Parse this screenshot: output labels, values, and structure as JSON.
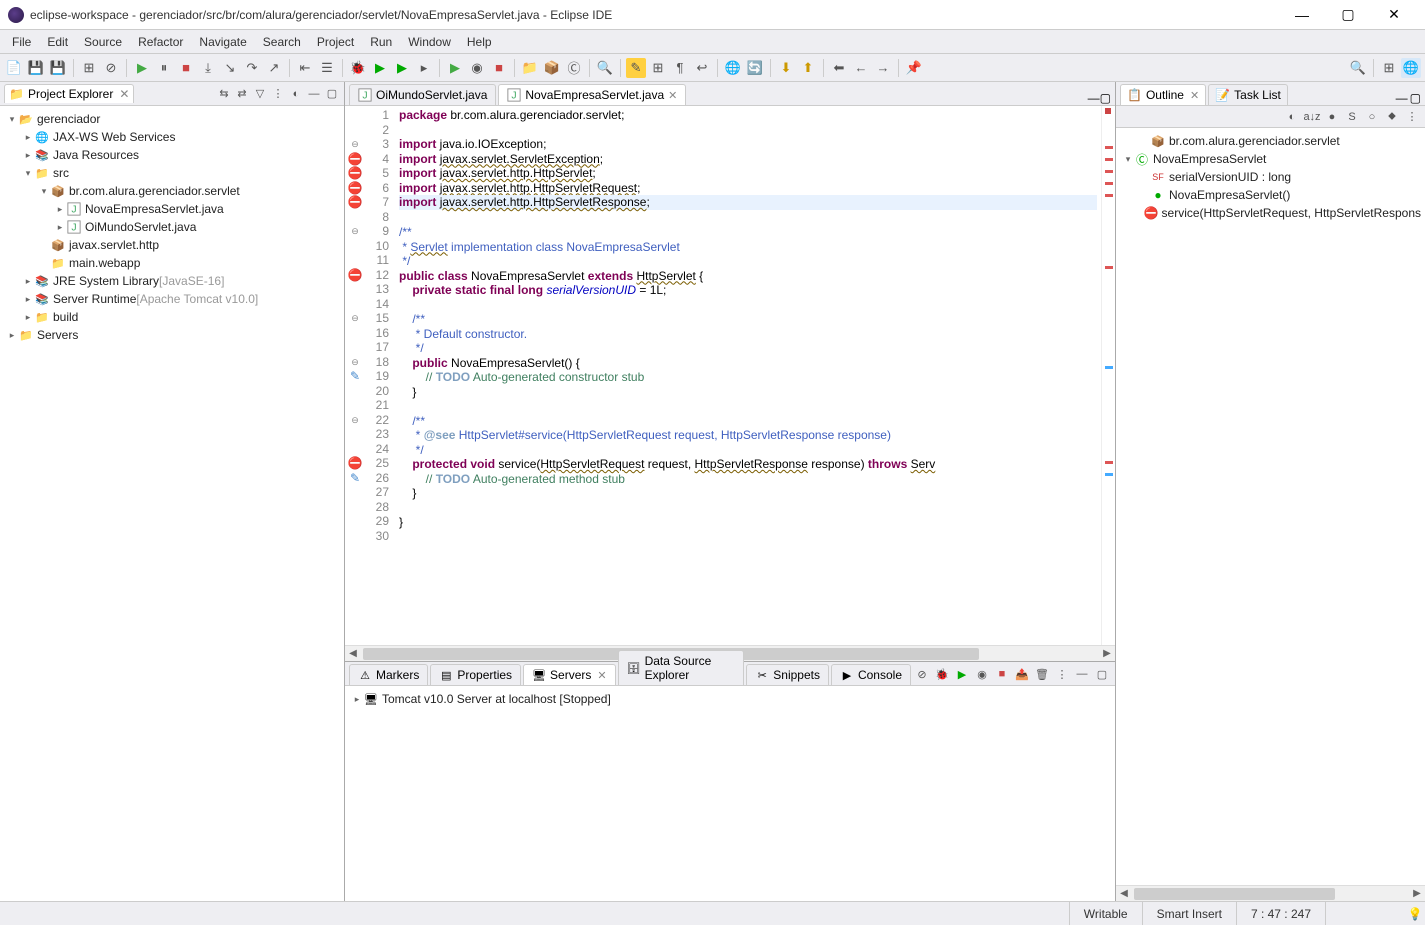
{
  "window": {
    "title": "eclipse-workspace - gerenciador/src/br/com/alura/gerenciador/servlet/NovaEmpresaServlet.java - Eclipse IDE"
  },
  "menu": [
    "File",
    "Edit",
    "Source",
    "Refactor",
    "Navigate",
    "Search",
    "Project",
    "Run",
    "Window",
    "Help"
  ],
  "project_explorer": {
    "title": "Project Explorer",
    "items": [
      {
        "indent": 0,
        "expanded": true,
        "icon": "project",
        "label": "gerenciador"
      },
      {
        "indent": 1,
        "expanded": false,
        "icon": "ws",
        "label": "JAX-WS Web Services"
      },
      {
        "indent": 1,
        "expanded": false,
        "icon": "jar",
        "label": "Java Resources"
      },
      {
        "indent": 1,
        "expanded": true,
        "icon": "src",
        "label": "src"
      },
      {
        "indent": 2,
        "expanded": true,
        "icon": "pkg",
        "label": "br.com.alura.gerenciador.servlet"
      },
      {
        "indent": 3,
        "expanded": false,
        "icon": "java",
        "label": "NovaEmpresaServlet.java"
      },
      {
        "indent": 3,
        "expanded": false,
        "icon": "java",
        "label": "OiMundoServlet.java"
      },
      {
        "indent": 2,
        "expanded": null,
        "icon": "pkg",
        "label": "javax.servlet.http"
      },
      {
        "indent": 2,
        "expanded": null,
        "icon": "folder",
        "label": "main.webapp"
      },
      {
        "indent": 1,
        "expanded": false,
        "icon": "lib",
        "label": "JRE System Library",
        "decor": "[JavaSE-16]"
      },
      {
        "indent": 1,
        "expanded": false,
        "icon": "lib",
        "label": "Server Runtime",
        "decor": "[Apache Tomcat v10.0]"
      },
      {
        "indent": 1,
        "expanded": false,
        "icon": "folder",
        "label": "build"
      },
      {
        "indent": 0,
        "expanded": false,
        "icon": "folder",
        "label": "Servers"
      }
    ]
  },
  "editor": {
    "tabs": [
      {
        "label": "OiMundoServlet.java",
        "active": false
      },
      {
        "label": "NovaEmpresaServlet.java",
        "active": true
      }
    ],
    "lines": [
      {
        "n": 1,
        "html": "<span class='kw'>package</span> br.com.alura.gerenciador.servlet;"
      },
      {
        "n": 2,
        "html": ""
      },
      {
        "n": 3,
        "ann": "⊖",
        "html": "<span class='kw'>import</span> java.io.IOException;"
      },
      {
        "n": 4,
        "ann": "err",
        "html": "<span class='kw'>import</span> <span class='wavy'>javax.servlet.ServletException</span>;"
      },
      {
        "n": 5,
        "ann": "err",
        "html": "<span class='kw'>import</span> <span class='wavy'>javax.servlet.http.HttpServlet</span>;"
      },
      {
        "n": 6,
        "ann": "err",
        "html": "<span class='kw'>import</span> <span class='wavy'>javax.servlet.http.HttpServletRequest</span>;"
      },
      {
        "n": 7,
        "ann": "err",
        "hl": true,
        "html": "<span class='kw'>import</span> <span class='wavy'>javax.servlet.http.HttpServletResponse</span>;"
      },
      {
        "n": 8,
        "html": ""
      },
      {
        "n": 9,
        "ann": "⊖",
        "html": "<span class='doccom'>/**</span>"
      },
      {
        "n": 10,
        "html": "<span class='doccom'> * <span class='wavy'>Servlet</span> implementation class NovaEmpresaServlet</span>"
      },
      {
        "n": 11,
        "html": "<span class='doccom'> */</span>"
      },
      {
        "n": 12,
        "ann": "err",
        "html": "<span class='kw'>public</span> <span class='kw'>class</span> NovaEmpresaServlet <span class='kw'>extends</span> <span class='wavy'>HttpServlet</span> {"
      },
      {
        "n": 13,
        "html": "    <span class='kw'>private</span> <span class='kw'>static</span> <span class='kw'>final</span> <span class='kw'>long</span> <span class='str-em'>serialVersionUID</span> = 1L;"
      },
      {
        "n": 14,
        "html": ""
      },
      {
        "n": 15,
        "ann": "⊖",
        "html": "    <span class='doccom'>/**</span>"
      },
      {
        "n": 16,
        "html": "    <span class='doccom'> * Default constructor.</span>"
      },
      {
        "n": 17,
        "html": "    <span class='doccom'> */</span>"
      },
      {
        "n": 18,
        "ann": "⊖",
        "html": "    <span class='kw'>public</span> NovaEmpresaServlet() {"
      },
      {
        "n": 19,
        "ann": "task",
        "html": "        <span class='com'>// <span class='todo'>TODO</span> Auto-generated constructor stub</span>"
      },
      {
        "n": 20,
        "html": "    }"
      },
      {
        "n": 21,
        "html": ""
      },
      {
        "n": 22,
        "ann": "⊖",
        "html": "    <span class='doccom'>/**</span>"
      },
      {
        "n": 23,
        "html": "    <span class='doccom'> * <span class='doctag'>@see</span> HttpServlet#service(HttpServletRequest request, HttpServletResponse response)</span>"
      },
      {
        "n": 24,
        "html": "    <span class='doccom'> */</span>"
      },
      {
        "n": 25,
        "ann": "err",
        "html": "    <span class='kw'>protected</span> <span class='kw'>void</span> service(<span class='wavy'>HttpServletRequest</span> request, <span class='wavy'>HttpServletResponse</span> response) <span class='kw'>throws</span> <span class='wavy'>Serv</span>"
      },
      {
        "n": 26,
        "ann": "task",
        "html": "        <span class='com'>// <span class='todo'>TODO</span> Auto-generated method stub</span>"
      },
      {
        "n": 27,
        "html": "    }"
      },
      {
        "n": 28,
        "html": ""
      },
      {
        "n": 29,
        "html": "}"
      },
      {
        "n": 30,
        "html": ""
      }
    ]
  },
  "outline": {
    "tabs": [
      {
        "label": "Outline",
        "active": true
      },
      {
        "label": "Task List",
        "active": false
      }
    ],
    "items": [
      {
        "indent": 1,
        "icon": "pkg",
        "label": "br.com.alura.gerenciador.servlet"
      },
      {
        "indent": 0,
        "expanded": true,
        "icon": "class-err",
        "label": "NovaEmpresaServlet"
      },
      {
        "indent": 1,
        "icon": "sf",
        "label": "serialVersionUID : long"
      },
      {
        "indent": 1,
        "icon": "constructor",
        "label": "NovaEmpresaServlet()"
      },
      {
        "indent": 1,
        "icon": "method-err",
        "label": "service(HttpServletRequest, HttpServletRespons"
      }
    ]
  },
  "bottom": {
    "tabs": [
      "Markers",
      "Properties",
      "Servers",
      "Data Source Explorer",
      "Snippets",
      "Console"
    ],
    "active": 2,
    "server_item": "Tomcat v10.0 Server at localhost  [Stopped]"
  },
  "status": {
    "writable": "Writable",
    "insert": "Smart Insert",
    "position": "7 : 47 : 247"
  }
}
